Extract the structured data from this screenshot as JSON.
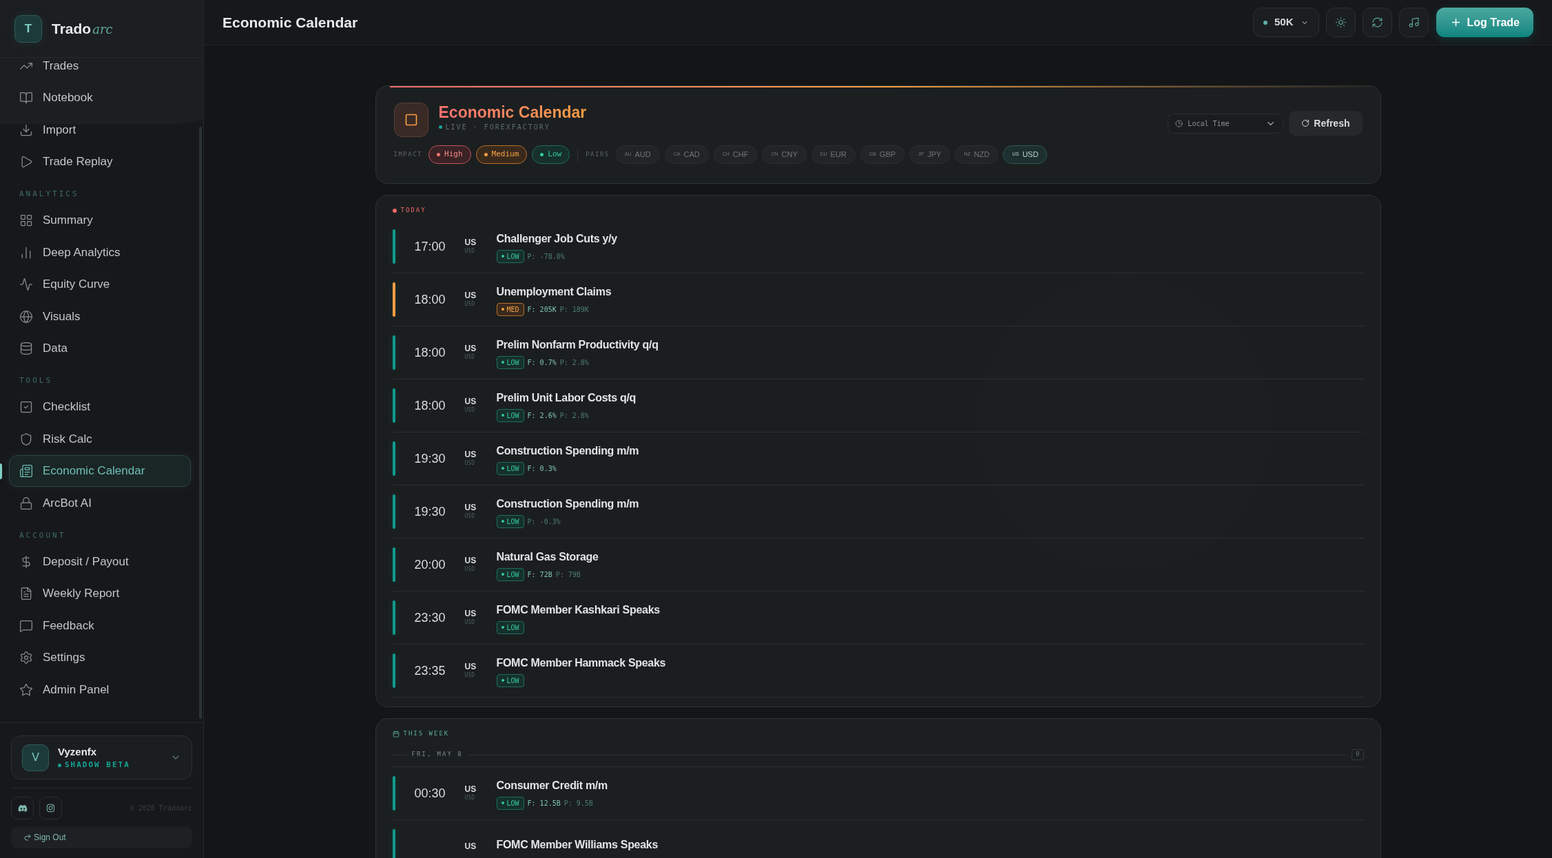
{
  "sidebar": {
    "brand": {
      "initial": "T",
      "name": "Trado",
      "suffix": "arc"
    },
    "sections": [
      {
        "items": [
          {
            "label": "Trades",
            "selected": false
          },
          {
            "label": "Notebook",
            "selected": false
          },
          {
            "label": "Import",
            "selected": false
          },
          {
            "label": "Trade Replay",
            "selected": false
          }
        ]
      },
      {
        "heading": "ANALYTICS",
        "items": [
          {
            "label": "Summary",
            "selected": false
          },
          {
            "label": "Deep Analytics",
            "selected": false
          },
          {
            "label": "Equity Curve",
            "selected": false
          },
          {
            "label": "Visuals",
            "selected": false
          },
          {
            "label": "Data",
            "selected": false
          }
        ]
      },
      {
        "heading": "TOOLS",
        "items": [
          {
            "label": "Checklist",
            "selected": false
          },
          {
            "label": "Risk Calc",
            "selected": false
          },
          {
            "label": "Economic Calendar",
            "selected": true
          },
          {
            "label": "ArcBot AI",
            "selected": false
          }
        ]
      },
      {
        "heading": "ACCOUNT",
        "items": [
          {
            "label": "Deposit / Payout",
            "selected": false
          },
          {
            "label": "Weekly Report",
            "selected": false
          },
          {
            "label": "Feedback",
            "selected": false
          },
          {
            "label": "Settings",
            "selected": false
          },
          {
            "label": "Admin Panel",
            "selected": false
          }
        ]
      }
    ],
    "user": {
      "initial": "V",
      "name": "Vyzenfx",
      "plan": "SHADOW BETA"
    },
    "copyright": "© 2026 Tradoarc",
    "sign_out": "Sign Out"
  },
  "header": {
    "title": "Economic Calendar",
    "account": "50K",
    "log_trade": "Log Trade"
  },
  "calendar": {
    "title": "Economic Calendar",
    "source": "LIVE · FOREXFACTORY",
    "timezone": "Local Time",
    "refresh": "Refresh",
    "impact_label": "IMPACT",
    "impacts": [
      {
        "kind": "high",
        "label": "High",
        "selected": true
      },
      {
        "kind": "medium",
        "label": "Medium",
        "selected": true
      },
      {
        "kind": "low",
        "label": "Low",
        "selected": true
      }
    ],
    "pairs_label": "PAIRS",
    "pairs": [
      {
        "code": "AU",
        "label": "AUD",
        "selected": false
      },
      {
        "code": "CA",
        "label": "CAD",
        "selected": false
      },
      {
        "code": "CH",
        "label": "CHF",
        "selected": false
      },
      {
        "code": "CN",
        "label": "CNY",
        "selected": false
      },
      {
        "code": "EU",
        "label": "EUR",
        "selected": false
      },
      {
        "code": "GB",
        "label": "GBP",
        "selected": false
      },
      {
        "code": "JP",
        "label": "JPY",
        "selected": false
      },
      {
        "code": "NZ",
        "label": "NZD",
        "selected": false
      },
      {
        "code": "US",
        "label": "USD",
        "selected": true
      }
    ]
  },
  "today": {
    "label": "TODAY",
    "events": [
      {
        "time": "17:00",
        "country": "US",
        "currency": "USD",
        "title": "Challenger Job Cuts y/y",
        "kind": "low",
        "impact_label": "LOW",
        "previous": "P: -78.0%"
      },
      {
        "time": "18:00",
        "country": "US",
        "currency": "USD",
        "title": "Unemployment Claims",
        "kind": "medium",
        "impact_label": "MED",
        "forecast": "F: 205K",
        "previous": "P: 189K"
      },
      {
        "time": "18:00",
        "country": "US",
        "currency": "USD",
        "title": "Prelim Nonfarm Productivity q/q",
        "kind": "low",
        "impact_label": "LOW",
        "forecast": "F: 0.7%",
        "previous": "P: 2.8%"
      },
      {
        "time": "18:00",
        "country": "US",
        "currency": "USD",
        "title": "Prelim Unit Labor Costs q/q",
        "kind": "low",
        "impact_label": "LOW",
        "forecast": "F: 2.6%",
        "previous": "P: 2.8%"
      },
      {
        "time": "19:30",
        "country": "US",
        "currency": "USD",
        "title": "Construction Spending m/m",
        "kind": "low",
        "impact_label": "LOW",
        "forecast": "F: 0.3%"
      },
      {
        "time": "19:30",
        "country": "US",
        "currency": "USD",
        "title": "Construction Spending m/m",
        "kind": "low",
        "impact_label": "LOW",
        "previous": "P: -0.3%"
      },
      {
        "time": "20:00",
        "country": "US",
        "currency": "USD",
        "title": "Natural Gas Storage",
        "kind": "low",
        "impact_label": "LOW",
        "forecast": "F: 72B",
        "previous": "P: 79B"
      },
      {
        "time": "23:30",
        "country": "US",
        "currency": "USD",
        "title": "FOMC Member Kashkari Speaks",
        "kind": "low",
        "impact_label": "LOW"
      },
      {
        "time": "23:35",
        "country": "US",
        "currency": "USD",
        "title": "FOMC Member Hammack Speaks",
        "kind": "low",
        "impact_label": "LOW"
      }
    ]
  },
  "week": {
    "label": "THIS WEEK",
    "days": [
      {
        "date": "FRI, MAY 8",
        "count": "9",
        "events": [
          {
            "time": "00:30",
            "country": "US",
            "currency": "USD",
            "title": "Consumer Credit m/m",
            "kind": "low",
            "impact_label": "LOW",
            "forecast": "F: 12.5B",
            "previous": "P: 9.5B"
          },
          {
            "country": "US",
            "title": "FOMC Member Williams Speaks",
            "kind": "low"
          }
        ]
      }
    ]
  }
}
